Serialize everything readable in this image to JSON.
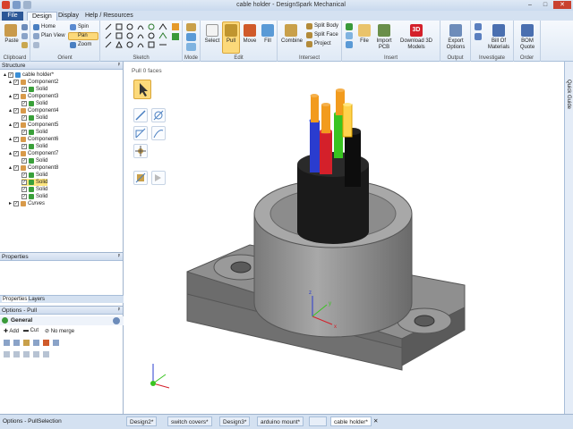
{
  "window": {
    "title": "cable holder - DesignSpark Mechanical"
  },
  "tabs": [
    {
      "label": "File"
    },
    {
      "label": "Design"
    },
    {
      "label": "Display"
    },
    {
      "label": "Help / Resources"
    }
  ],
  "ribbon": {
    "clipboard": {
      "label": "Clipboard",
      "paste": "Paste"
    },
    "orient": {
      "label": "Orient",
      "home": "Home",
      "spin": "Spin",
      "plan_view": "Plan View",
      "pan": "Pan",
      "zoom": "Zoom"
    },
    "sketch": {
      "label": "Sketch"
    },
    "mode": {
      "label": "Mode"
    },
    "edit": {
      "label": "Edit",
      "select": "Select",
      "pull": "Pull",
      "move": "Move",
      "fill": "Fill"
    },
    "intersect": {
      "label": "Intersect",
      "combine": "Combine",
      "split_body": "Split Body",
      "split_face": "Split Face",
      "project": "Project"
    },
    "insert": {
      "label": "Insert",
      "file": "File",
      "import_pcb": "Import PCB",
      "download_3d": "Download 3D Models"
    },
    "output": {
      "label": "Output",
      "export": "Export Options"
    },
    "investigate": {
      "label": "Investigate",
      "bom": "Bill Of Materials"
    },
    "order": {
      "label": "Order",
      "bom_quote": "BOM Quote"
    }
  },
  "structure": {
    "title": "Structure",
    "root": "cable holder*",
    "items": [
      {
        "label": "Component2",
        "children": [
          "Solid"
        ]
      },
      {
        "label": "Component3",
        "children": [
          "Solid"
        ]
      },
      {
        "label": "Component4",
        "children": [
          "Solid"
        ]
      },
      {
        "label": "Component5",
        "children": [
          "Solid"
        ]
      },
      {
        "label": "Component6",
        "children": [
          "Solid"
        ]
      },
      {
        "label": "Component7",
        "children": [
          "Solid"
        ]
      },
      {
        "label": "Component8",
        "children": [
          "Solid",
          "Solid",
          "Solid",
          "Solid"
        ]
      }
    ],
    "curves": "Curves"
  },
  "properties": {
    "title": "Properties",
    "tab1": "Properties",
    "tab2": "Layers"
  },
  "options": {
    "title": "Options - Pull",
    "general": "General",
    "add": "Add",
    "cut": "Cut",
    "no_merge": "No merge"
  },
  "viewport": {
    "status": "Pull 0 faces"
  },
  "quick_guide": "Quick Guide",
  "status_bar": {
    "left1": "Options - Pull",
    "left2": "Selection"
  },
  "doc_tabs": [
    "Design2*",
    "switch covers*",
    "Design3*",
    "arduino mount*",
    "",
    "cable holder*"
  ],
  "colors": {
    "accent": "#2b5797",
    "model_gray": "#8a8a8a",
    "wire_orange": "#f29b1d",
    "wire_blue": "#2a3ccf",
    "wire_red": "#d4202a",
    "wire_green": "#39c420",
    "selection_yellow": "#ffe680"
  }
}
